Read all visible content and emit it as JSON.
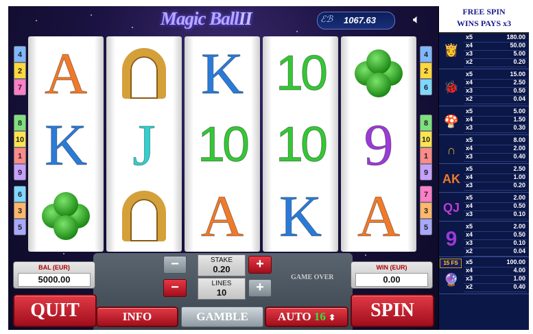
{
  "header": {
    "logo_main": "Magic Ball",
    "logo_num": "II",
    "balance_icon": "eb-coin-icon",
    "balance_value": "1067.63",
    "sound_icon": "speaker-icon"
  },
  "line_numbers": {
    "left_top": [
      "4",
      "2",
      "7"
    ],
    "left_mid": [
      "8",
      "10",
      "1",
      "9"
    ],
    "left_bot": [
      "6",
      "3",
      "5"
    ],
    "right_top": [
      "4",
      "2",
      "6"
    ],
    "right_mid": [
      "8",
      "10",
      "1",
      "9"
    ],
    "right_bot": [
      "7",
      "3",
      "5"
    ]
  },
  "line_colors": {
    "4": "#7eb8ff",
    "2": "#ffd83d",
    "7": "#ff7ec8",
    "8": "#7de07d",
    "10": "#ffe44d",
    "1": "#ff8a8a",
    "9": "#c6a0ff",
    "6": "#7ed8ff",
    "3": "#ffb86b",
    "5": "#a8a8ff"
  },
  "reels": [
    [
      "A",
      "K",
      "clover"
    ],
    [
      "horseshoe",
      "J",
      "horseshoe"
    ],
    [
      "K",
      "10",
      "A"
    ],
    [
      "10",
      "10",
      "K"
    ],
    [
      "clover",
      "9",
      "A"
    ]
  ],
  "symbol_colors": {
    "A": "#f07a2a",
    "K": "#2a7bd8",
    "J": "#2fd0d0",
    "10": "#35c735",
    "9": "#9b3ad6"
  },
  "bottom": {
    "bal_label": "BAL (EUR)",
    "bal_value": "5000.00",
    "win_label": "WIN (EUR)",
    "win_value": "0.00",
    "stake_label": "STAKE",
    "stake_value": "0.20",
    "lines_label": "LINES",
    "lines_value": "10",
    "game_over": "GAME OVER",
    "quit": "QUIT",
    "info": "INFO",
    "gamble": "GAMBLE",
    "auto": "AUTO",
    "auto_count": "16",
    "spin": "SPIN",
    "minus": "−",
    "plus": "+"
  },
  "paytable": {
    "header_line1": "FREE SPIN",
    "header_line2": "WINS PAYS x3",
    "groups": [
      {
        "icon": "fortune-teller-icon",
        "rows": [
          [
            "x5",
            "180.00"
          ],
          [
            "x4",
            "50.00"
          ],
          [
            "x3",
            "5.00"
          ],
          [
            "x2",
            "0.20"
          ]
        ]
      },
      {
        "icon": "ladybug-pig-icon",
        "rows": [
          [
            "x5",
            "15.00"
          ],
          [
            "x4",
            "2.50"
          ],
          [
            "x3",
            "0.50"
          ],
          [
            "x2",
            "0.04"
          ]
        ]
      },
      {
        "icon": "mushroom-clover-icon",
        "rows": [
          [
            "x5",
            "5.00"
          ],
          [
            "x4",
            "1.50"
          ],
          [
            "x3",
            "0.30"
          ]
        ]
      },
      {
        "icon": "horseshoe-icon",
        "rows": [
          [
            "x5",
            "8.00"
          ],
          [
            "x4",
            "2.00"
          ],
          [
            "x3",
            "0.40"
          ]
        ]
      },
      {
        "icon": "ak-icon",
        "rows": [
          [
            "x5",
            "2.50"
          ],
          [
            "x4",
            "1.00"
          ],
          [
            "x3",
            "0.20"
          ]
        ]
      },
      {
        "icon": "qj10-icon",
        "rows": [
          [
            "x5",
            "2.00"
          ],
          [
            "x4",
            "0.50"
          ],
          [
            "x3",
            "0.10"
          ]
        ]
      },
      {
        "icon": "nine-icon",
        "rows": [
          [
            "x5",
            "2.00"
          ],
          [
            "x4",
            "0.50"
          ],
          [
            "x3",
            "0.10"
          ],
          [
            "x2",
            "0.04"
          ]
        ]
      },
      {
        "icon": "magic-ball-icon",
        "badge": "15 FS",
        "rows": [
          [
            "x5",
            "100.00"
          ],
          [
            "x4",
            "4.00"
          ],
          [
            "x3",
            "1.00"
          ],
          [
            "x2",
            "0.40"
          ]
        ]
      }
    ]
  }
}
